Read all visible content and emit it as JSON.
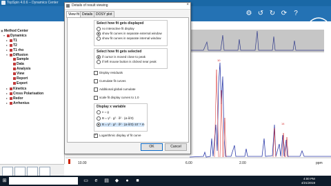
{
  "app": {
    "title": "TopSpin 4.0.6 – Dynamics Center"
  },
  "dialog": {
    "title": "Details of result viewing",
    "close": "×",
    "tabs": [
      "View fit",
      "Details",
      "DOSY plot"
    ],
    "display_group": {
      "title": "Select how fit gets displayed",
      "options": [
        "no interactive fit display",
        "show fit curves in separate external window",
        "show fit curves in separate internal window"
      ],
      "selected": 1
    },
    "selection_group": {
      "title": "Select how fit gets selected",
      "options": [
        "if cursor is moved close to peak",
        "if left mouse button is clicked near peak"
      ],
      "selected": 0
    },
    "checkboxes": [
      {
        "label": "Display residuals",
        "checked": false
      },
      {
        "label": "Cumulate fit curves",
        "checked": false
      },
      {
        "label": "Additional global cumulate",
        "checked": false
      },
      {
        "label": "scale fit display curves to 1.0",
        "checked": false
      }
    ],
    "variable_group": {
      "title": "Display x variable",
      "options": [
        "x = g",
        "B = γ² · g² · δ² · (Δ-δ/3)",
        "B = γ² · g² · δ² · (Δ-δ/3)·10⁻⁴ m"
      ],
      "selected": 2
    },
    "log_checkbox": {
      "label": "Logarithmic display of fit curve",
      "checked": true
    },
    "ok": "OK",
    "cancel": "Cancel"
  },
  "tree": {
    "items": [
      {
        "label": "Method Center",
        "bold": true,
        "indent": 0
      },
      {
        "label": "Dynamics",
        "bold": true,
        "indent": 1
      },
      {
        "label": "T1",
        "bold": true,
        "indent": 2
      },
      {
        "label": "T2",
        "bold": true,
        "indent": 2
      },
      {
        "label": "T1 rho",
        "bold": true,
        "indent": 2
      },
      {
        "label": "Diffusion",
        "bold": true,
        "indent": 2
      },
      {
        "label": "Sample",
        "bold": true,
        "indent": 3
      },
      {
        "label": "Data",
        "bold": true,
        "indent": 3
      },
      {
        "label": "Analysis",
        "bold": true,
        "indent": 3
      },
      {
        "label": "View",
        "bold": true,
        "indent": 3
      },
      {
        "label": "Report",
        "bold": true,
        "indent": 3
      },
      {
        "label": "Export",
        "bold": true,
        "indent": 3
      },
      {
        "label": "Kinetics",
        "bold": true,
        "indent": 2
      },
      {
        "label": "Cross Polarisation",
        "bold": true,
        "indent": 2
      },
      {
        "label": "Redor",
        "bold": true,
        "indent": 2
      },
      {
        "label": "Arrhenius",
        "bold": true,
        "indent": 2
      }
    ]
  },
  "spectrum": {
    "x_ticks": [
      "10.00",
      "6.00",
      "2.00",
      "ppm"
    ]
  },
  "taskbar": {
    "search_placeholder": "",
    "time": "4:00 PM",
    "date": "4/21/2019"
  }
}
